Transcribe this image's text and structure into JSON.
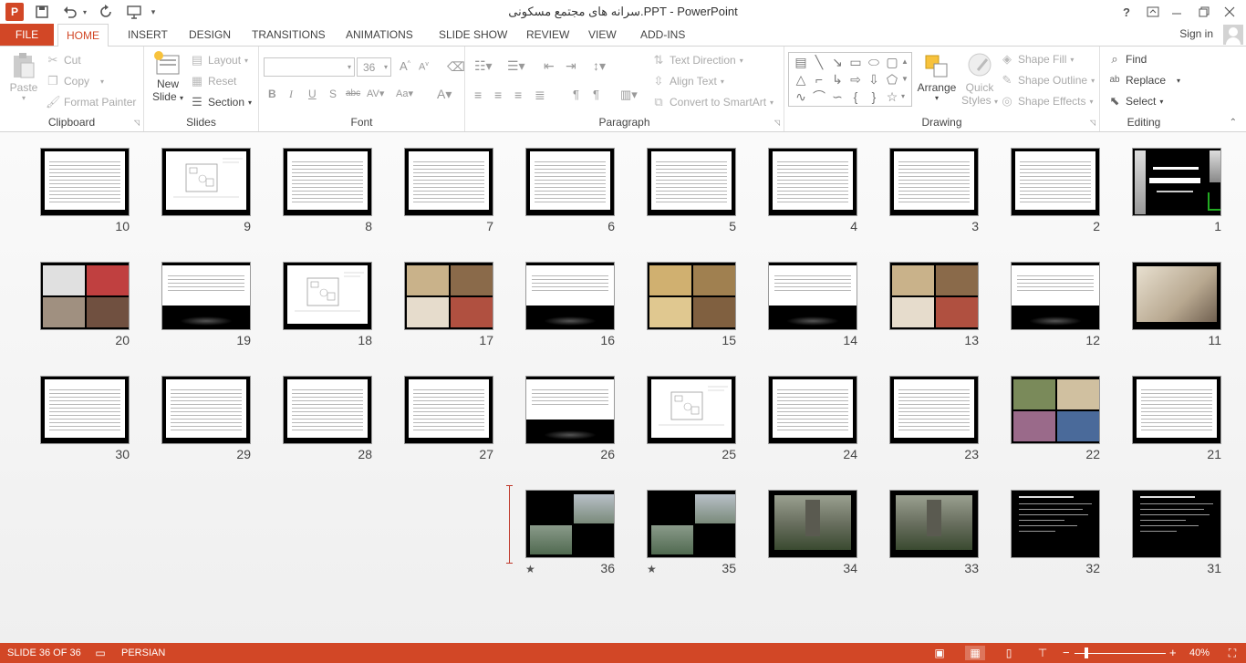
{
  "window": {
    "title": "سرانه های مجتمع مسکونی.PPT - PowerPoint",
    "help": "?",
    "app_letter": "P"
  },
  "tabs": [
    "FILE",
    "HOME",
    "INSERT",
    "DESIGN",
    "TRANSITIONS",
    "ANIMATIONS",
    "SLIDE SHOW",
    "REVIEW",
    "VIEW",
    "ADD-INS"
  ],
  "sign_in": "Sign in",
  "ribbon": {
    "clipboard": {
      "label": "Clipboard",
      "paste": "Paste",
      "cut": "Cut",
      "copy": "Copy",
      "format_painter": "Format Painter"
    },
    "slides": {
      "label": "Slides",
      "new_slide_1": "New",
      "new_slide_2": "Slide",
      "layout": "Layout",
      "reset": "Reset",
      "section": "Section"
    },
    "font": {
      "label": "Font",
      "size": "36"
    },
    "paragraph": {
      "label": "Paragraph",
      "text_direction": "Text Direction",
      "align_text": "Align Text",
      "convert_smartart": "Convert to SmartArt"
    },
    "drawing": {
      "label": "Drawing",
      "arrange": "Arrange",
      "quick_styles_1": "Quick",
      "quick_styles_2": "Styles",
      "shape_fill": "Shape Fill",
      "shape_outline": "Shape Outline",
      "shape_effects": "Shape Effects"
    },
    "editing": {
      "label": "Editing",
      "find": "Find",
      "replace": "Replace",
      "select": "Select"
    }
  },
  "slides": [
    {
      "n": "1",
      "kind": "title"
    },
    {
      "n": "2",
      "kind": "text"
    },
    {
      "n": "3",
      "kind": "text"
    },
    {
      "n": "4",
      "kind": "text"
    },
    {
      "n": "5",
      "kind": "text"
    },
    {
      "n": "6",
      "kind": "text"
    },
    {
      "n": "7",
      "kind": "text"
    },
    {
      "n": "8",
      "kind": "text"
    },
    {
      "n": "9",
      "kind": "plan"
    },
    {
      "n": "10",
      "kind": "text"
    },
    {
      "n": "11",
      "kind": "photo"
    },
    {
      "n": "12",
      "kind": "textshort"
    },
    {
      "n": "13",
      "kind": "photos"
    },
    {
      "n": "14",
      "kind": "textshort"
    },
    {
      "n": "15",
      "kind": "photos"
    },
    {
      "n": "16",
      "kind": "textshort"
    },
    {
      "n": "17",
      "kind": "photos"
    },
    {
      "n": "18",
      "kind": "plan"
    },
    {
      "n": "19",
      "kind": "textshort"
    },
    {
      "n": "20",
      "kind": "photos"
    },
    {
      "n": "21",
      "kind": "text"
    },
    {
      "n": "22",
      "kind": "photos"
    },
    {
      "n": "23",
      "kind": "text"
    },
    {
      "n": "24",
      "kind": "text"
    },
    {
      "n": "25",
      "kind": "plan"
    },
    {
      "n": "26",
      "kind": "textshort"
    },
    {
      "n": "27",
      "kind": "text"
    },
    {
      "n": "28",
      "kind": "text"
    },
    {
      "n": "29",
      "kind": "text"
    },
    {
      "n": "30",
      "kind": "text"
    },
    {
      "n": "31",
      "kind": "dark"
    },
    {
      "n": "32",
      "kind": "dark"
    },
    {
      "n": "33",
      "kind": "landscape"
    },
    {
      "n": "34",
      "kind": "landscape"
    },
    {
      "n": "35",
      "kind": "render",
      "star": "★"
    },
    {
      "n": "36",
      "kind": "render",
      "star": "★"
    }
  ],
  "status": {
    "slide": "SLIDE 36 OF 36",
    "language": "PERSIAN",
    "zoom": "40%",
    "minus": "−",
    "plus": "+"
  },
  "colors": {
    "accent": "#d24726"
  }
}
